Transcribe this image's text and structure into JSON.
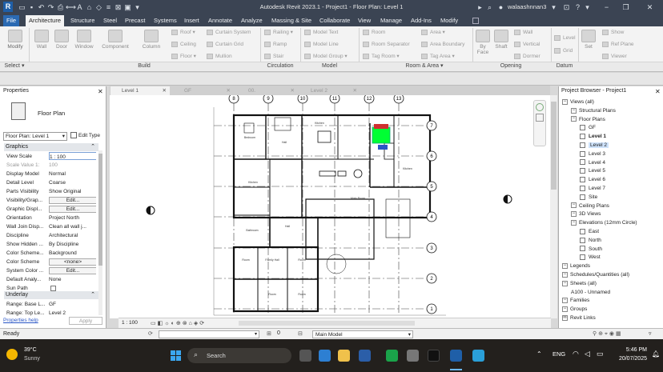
{
  "app": {
    "title": "Autodesk Revit 2023.1 - Project1 - Floor Plan: Level 1",
    "user": "walaashnnan3"
  },
  "menu": [
    "File",
    "Architecture",
    "Structure",
    "Steel",
    "Precast",
    "Systems",
    "Insert",
    "Annotate",
    "Analyze",
    "Massing & Site",
    "Collaborate",
    "View",
    "Manage",
    "Add-Ins",
    "Modify"
  ],
  "ribbon": {
    "build_big": [
      "Modify",
      "Wall",
      "Door",
      "Window",
      "Component",
      "Column"
    ],
    "build_small": [
      "Roof",
      "Ceiling",
      "Floor",
      "Curtain System",
      "Curtain Grid",
      "Mullion"
    ],
    "circulation": [
      "Railing",
      "Ramp",
      "Stair"
    ],
    "model": [
      "Model Text",
      "Model Line",
      "Model Group"
    ],
    "room": [
      "Room",
      "Room Separator",
      "Tag Room",
      "Area",
      "Area Boundary",
      "Tag Area"
    ],
    "opening": [
      "By Face",
      "Shaft",
      "Wall",
      "Vertical",
      "Dormer"
    ],
    "datum": [
      "Level",
      "Grid"
    ],
    "workplane": [
      "Set",
      "Show",
      "Ref Plane",
      "Viewer"
    ],
    "panels": [
      "Select",
      "Build",
      "Circulation",
      "Model",
      "Room & Area",
      "Opening",
      "Datum"
    ]
  },
  "properties": {
    "header": "Properties",
    "type_name": "Floor Plan",
    "selector": "Floor Plan: Level 1",
    "edit_type": "Edit Type",
    "section_graphics": "Graphics",
    "rows": [
      {
        "k": "View Scale",
        "v": "1 : 100"
      },
      {
        "k": "Scale Value    1:",
        "v": "100"
      },
      {
        "k": "Display Model",
        "v": "Normal"
      },
      {
        "k": "Detail Level",
        "v": "Coarse"
      },
      {
        "k": "Parts Visibility",
        "v": "Show Original"
      },
      {
        "k": "Visibility/Grap...",
        "v": "Edit..."
      },
      {
        "k": "Graphic Displ...",
        "v": "Edit..."
      },
      {
        "k": "Orientation",
        "v": "Project North"
      },
      {
        "k": "Wall Join Disp...",
        "v": "Clean all wall j..."
      },
      {
        "k": "Discipline",
        "v": "Architectural"
      },
      {
        "k": "Show Hidden ...",
        "v": "By Discipline"
      },
      {
        "k": "Color Scheme...",
        "v": "Background"
      },
      {
        "k": "Color Scheme",
        "v": "<none>"
      },
      {
        "k": "System Color ...",
        "v": "Edit..."
      },
      {
        "k": "Default Analy...",
        "v": "None"
      },
      {
        "k": "Sun Path",
        "v": ""
      }
    ],
    "section_underlay": "Underlay",
    "underlay_rows": [
      {
        "k": "Range: Base L...",
        "v": "GF"
      },
      {
        "k": "Range: Top Le...",
        "v": "Level 2"
      }
    ],
    "help": "Properties help",
    "apply": "Apply"
  },
  "view_tabs": [
    "Level 1",
    "GF",
    "00.",
    "Level 2"
  ],
  "browser": {
    "title": "Project Browser - Project1",
    "items": [
      {
        "label": "Views (all)",
        "indent": 0,
        "kind": "exp"
      },
      {
        "label": "Structural Plans",
        "indent": 1,
        "kind": "exp"
      },
      {
        "label": "Floor Plans",
        "indent": 1,
        "kind": "exp"
      },
      {
        "label": "GF",
        "indent": 2,
        "kind": "box"
      },
      {
        "label": "Level 1",
        "indent": 2,
        "kind": "box",
        "bold": true
      },
      {
        "label": "Level 2",
        "indent": 2,
        "kind": "box",
        "sel": true
      },
      {
        "label": "Level 3",
        "indent": 2,
        "kind": "box"
      },
      {
        "label": "Level 4",
        "indent": 2,
        "kind": "box"
      },
      {
        "label": "Level 5",
        "indent": 2,
        "kind": "box"
      },
      {
        "label": "Level 6",
        "indent": 2,
        "kind": "box"
      },
      {
        "label": "Level 7",
        "indent": 2,
        "kind": "box"
      },
      {
        "label": "Site",
        "indent": 2,
        "kind": "box"
      },
      {
        "label": "Ceiling Plans",
        "indent": 1,
        "kind": "exp"
      },
      {
        "label": "3D Views",
        "indent": 1,
        "kind": "exp"
      },
      {
        "label": "Elevations (12mm Circle)",
        "indent": 1,
        "kind": "exp"
      },
      {
        "label": "East",
        "indent": 2,
        "kind": "box"
      },
      {
        "label": "North",
        "indent": 2,
        "kind": "box"
      },
      {
        "label": "South",
        "indent": 2,
        "kind": "box"
      },
      {
        "label": "West",
        "indent": 2,
        "kind": "box"
      },
      {
        "label": "Legends",
        "indent": 0,
        "kind": "exp"
      },
      {
        "label": "Schedules/Quantities (all)",
        "indent": 0,
        "kind": "exp"
      },
      {
        "label": "Sheets (all)",
        "indent": 0,
        "kind": "exp"
      },
      {
        "label": "A100 - Unnamed",
        "indent": 1,
        "kind": "none"
      },
      {
        "label": "Families",
        "indent": 0,
        "kind": "exp"
      },
      {
        "label": "Groups",
        "indent": 0,
        "kind": "exp"
      },
      {
        "label": "Revit Links",
        "indent": 0,
        "kind": "link"
      }
    ]
  },
  "grid_top": [
    "8",
    "9",
    "10",
    "11",
    "12",
    "13"
  ],
  "grid_right": [
    "7",
    "6",
    "5",
    "4",
    "3",
    "2",
    "1"
  ],
  "status": {
    "ready": "Ready",
    "scale": "1 : 100",
    "zero": "0",
    "model": "Main Model"
  },
  "taskbar": {
    "temp": "39°C",
    "weather": "Sunny",
    "search": "Search",
    "lang": "ENG",
    "time": "5:46 PM",
    "date": "20/07/2025"
  },
  "colors": {
    "titlebar": "#3b4453",
    "file_tab": "#2b6ab3",
    "highlight": "#00ff33"
  }
}
